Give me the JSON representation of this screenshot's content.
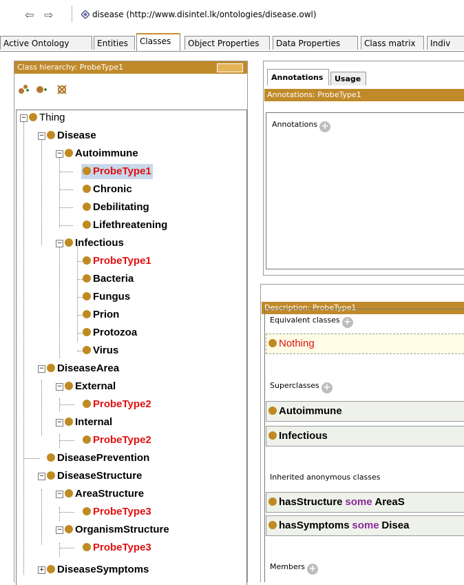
{
  "address_bar": {
    "back": "⇦",
    "forward": "⇨",
    "ontology_title": "disease (http://www.disintel.lk/ontologies/disease.owl)"
  },
  "tabs": [
    "Active Ontology",
    "Entities",
    "Classes",
    "Object Properties",
    "Data Properties",
    "Class matrix",
    "Indiv"
  ],
  "class_hierarchy": {
    "header": "Class hierarchy: ProbeType1",
    "tree": {
      "thing": "Thing",
      "disease": "Disease",
      "autoimmune": "Autoimmune",
      "probetype1_a": "ProbeType1",
      "chronic": "Chronic",
      "debilitating": "Debilitating",
      "lifethreatening": "Lifethreatening",
      "infectious": "Infectious",
      "probetype1_b": "ProbeType1",
      "bacteria": "Bacteria",
      "fungus": "Fungus",
      "prion": "Prion",
      "protozoa": "Protozoa",
      "virus": "Virus",
      "diseasearea": "DiseaseArea",
      "external": "External",
      "probetype2_a": "ProbeType2",
      "internal": "Internal",
      "probetype2_b": "ProbeType2",
      "diseaseprevention": "DiseasePrevention",
      "diseasestructure": "DiseaseStructure",
      "areastructure": "AreaStructure",
      "probetype3_a": "ProbeType3",
      "organismstructure": "OrganismStructure",
      "probetype3_b": "ProbeType3",
      "diseasesymptoms": "DiseaseSymptoms"
    }
  },
  "annotations": {
    "tabs": [
      "Annotations",
      "Usage"
    ],
    "header": "Annotations: ProbeType1",
    "section_label": "Annotations"
  },
  "description": {
    "header": "Description: ProbeType1",
    "equivalent_label": "Equivalent classes",
    "equivalent": [
      "Nothing"
    ],
    "superclasses_label": "Superclasses",
    "superclasses": [
      "Autoimmune",
      "Infectious"
    ],
    "inherited_label": "Inherited anonymous classes",
    "inherited": [
      {
        "prop": "hasStructure",
        "kw": "some",
        "cls": "AreaS"
      },
      {
        "prop": "hasSymptoms",
        "kw": "some",
        "cls": "Disea"
      }
    ],
    "members_label": "Members"
  },
  "colors": {
    "accent": "#c08a2a",
    "selected_bg": "#c9d7ea",
    "probe_red": "#e01010",
    "keyword": "#8a2a9a"
  }
}
